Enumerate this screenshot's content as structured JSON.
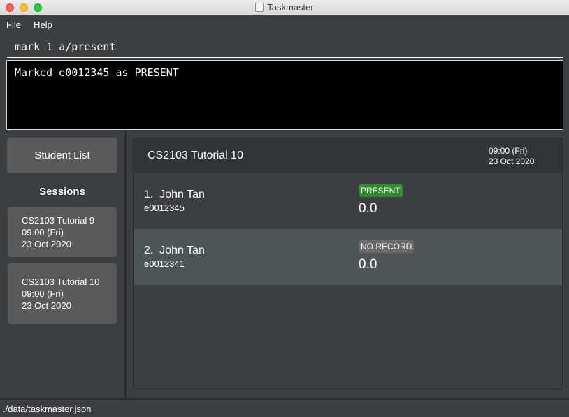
{
  "window": {
    "title": "Taskmaster"
  },
  "menu": {
    "items": [
      "File",
      "Help"
    ]
  },
  "command_box": {
    "value": "mark 1 a/present"
  },
  "result_display": {
    "text": "Marked e0012345 as PRESENT"
  },
  "sidebar": {
    "student_list_button": "Student List",
    "sessions_header": "Sessions",
    "sessions": [
      {
        "name": "CS2103 Tutorial 9",
        "time": "09:00 (Fri)",
        "date": "23 Oct 2020"
      },
      {
        "name": "CS2103 Tutorial 10",
        "time": "09:00 (Fri)",
        "date": "23 Oct 2020"
      }
    ]
  },
  "session_view": {
    "name": "CS2103 Tutorial 10",
    "time": "09:00 (Fri)",
    "date": "23 Oct 2020",
    "records": [
      {
        "index": "1.",
        "name": "John Tan",
        "id": "e0012345",
        "status": "PRESENT",
        "score": "0.0",
        "status_color": "#2e8b2e"
      },
      {
        "index": "2.",
        "name": "John Tan",
        "id": "e0012341",
        "status": "NO RECORD",
        "score": "0.0",
        "status_color": "#6b6b6b"
      }
    ]
  },
  "status_bar": {
    "path": "./data/taskmaster.json"
  },
  "colors": {
    "background": "#3c3f41",
    "card": "#5a5a5a",
    "row_alt": "#4e5557",
    "row": "#3c3f41",
    "present": "#2e8b2e",
    "no_record": "#6b6b6b"
  }
}
